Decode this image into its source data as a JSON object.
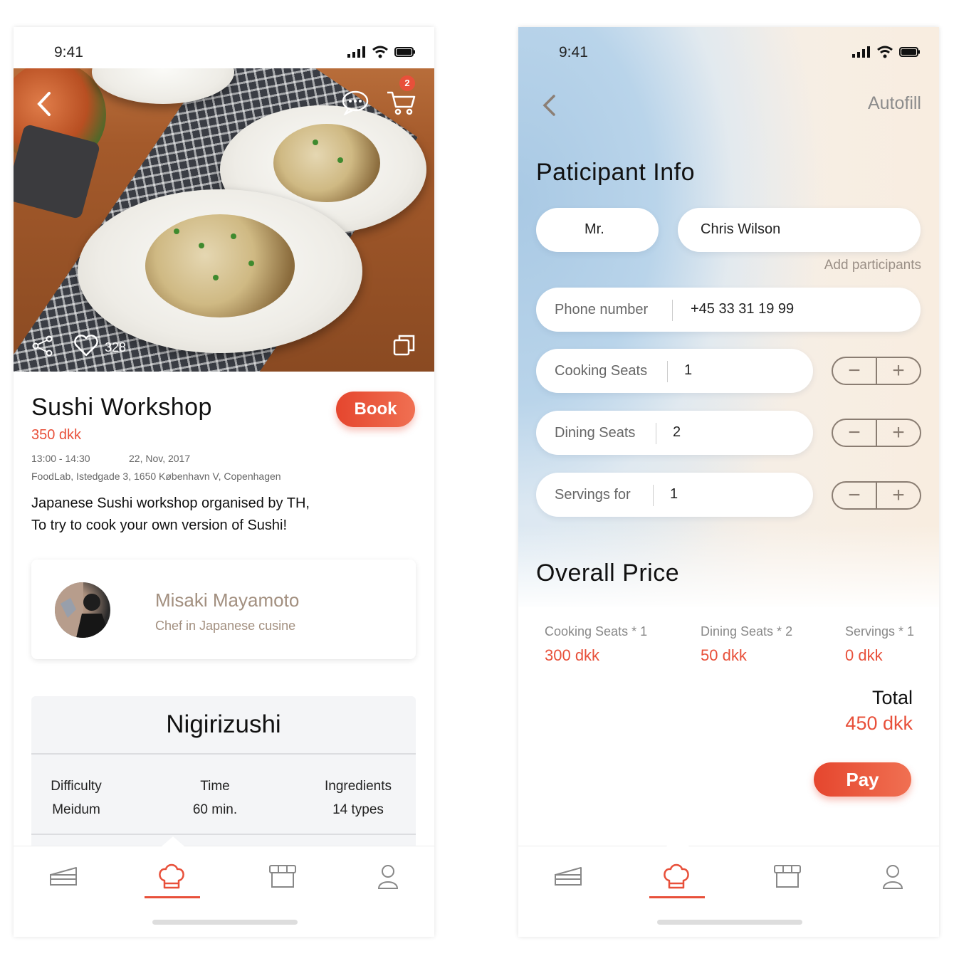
{
  "colors": {
    "accent": "#e8503a",
    "muted_brown": "#a28f7f"
  },
  "left": {
    "status": {
      "time": "9:41"
    },
    "hero": {
      "cart_count": "2",
      "like_count": "328"
    },
    "event": {
      "title": "Sushi Workshop",
      "price": "350 dkk",
      "book_label": "Book",
      "time": "13:00 - 14:30",
      "date": "22, Nov, 2017",
      "address": "FoodLab, Istedgade 3, 1650 København V, Copenhagen",
      "desc_line1": "Japanese Sushi workshop organised by TH,",
      "desc_line2": "To try to cook your own version of Sushi!"
    },
    "chef": {
      "name": "Misaki Mayamoto",
      "role": "Chef in Japanese cusine"
    },
    "recipe": {
      "title": "Nigirizushi",
      "stats": [
        {
          "label": "Difficulty",
          "value": "Meidum"
        },
        {
          "label": "Time",
          "value": "60 min."
        },
        {
          "label": "Ingredients",
          "value": "14 types"
        }
      ]
    },
    "tabs": [
      "cake-icon",
      "chef-hat-icon",
      "store-icon",
      "profile-icon"
    ],
    "active_tab": 1
  },
  "right": {
    "status": {
      "time": "9:41"
    },
    "header": {
      "action_label": "Autofill"
    },
    "participant": {
      "section_title": "Paticipant Info",
      "salutation": "Mr.",
      "name": "Chris Wilson",
      "add_participants_label": "Add participants",
      "phone_label": "Phone number",
      "phone_value": "+45  33 31 19 99"
    },
    "seats": [
      {
        "label": "Cooking Seats",
        "value": "1",
        "minus": "−",
        "plus": "+"
      },
      {
        "label": "Dining Seats",
        "value": "2",
        "minus": "−",
        "plus": "+"
      },
      {
        "label": "Servings for",
        "value": "1",
        "minus": "−",
        "plus": "+"
      }
    ],
    "price": {
      "section_title": "Overall Price",
      "items": [
        {
          "label": "Cooking Seats * 1",
          "value": "300 dkk"
        },
        {
          "label": "Dining Seats * 2",
          "value": "50 dkk"
        },
        {
          "label": "Servings * 1",
          "value": "0 dkk"
        }
      ],
      "total_label": "Total",
      "total_value": "450 dkk",
      "pay_label": "Pay"
    },
    "active_tab": 1
  }
}
